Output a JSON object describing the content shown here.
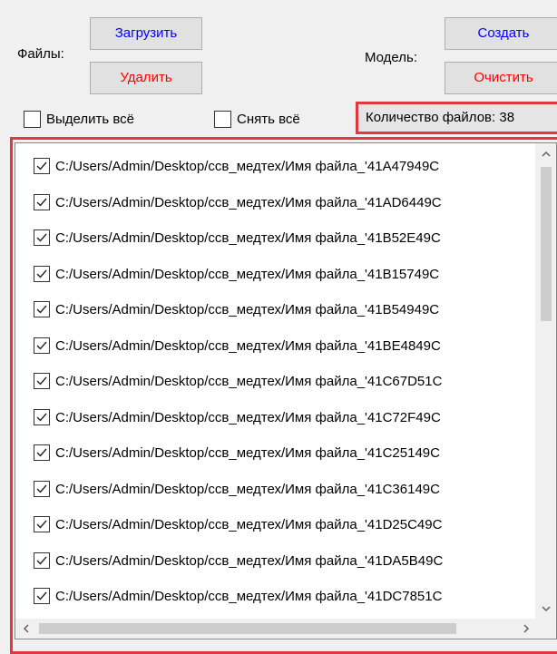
{
  "files": {
    "label": "Файлы:",
    "load_label": "Загрузить",
    "delete_label": "Удалить"
  },
  "model": {
    "label": "Модель:",
    "create_label": "Создать",
    "clear_label": "Очистить"
  },
  "selection": {
    "select_all_label": "Выделить всё",
    "deselect_all_label": "Снять всё"
  },
  "file_count": {
    "text": "Количество файлов: 38"
  },
  "file_list": {
    "items": [
      {
        "path": "C:/Users/Admin/Desktop/ссв_медтех/Имя файла_'41A47949C",
        "checked": true
      },
      {
        "path": "C:/Users/Admin/Desktop/ссв_медтех/Имя файла_'41AD6449C",
        "checked": true
      },
      {
        "path": "C:/Users/Admin/Desktop/ссв_медтех/Имя файла_'41B52E49C",
        "checked": true
      },
      {
        "path": "C:/Users/Admin/Desktop/ссв_медтех/Имя файла_'41B15749C",
        "checked": true
      },
      {
        "path": "C:/Users/Admin/Desktop/ссв_медтех/Имя файла_'41B54949C",
        "checked": true
      },
      {
        "path": "C:/Users/Admin/Desktop/ссв_медтех/Имя файла_'41BE4849C",
        "checked": true
      },
      {
        "path": "C:/Users/Admin/Desktop/ссв_медтех/Имя файла_'41C67D51C",
        "checked": true
      },
      {
        "path": "C:/Users/Admin/Desktop/ссв_медтех/Имя файла_'41C72F49C",
        "checked": true
      },
      {
        "path": "C:/Users/Admin/Desktop/ссв_медтех/Имя файла_'41C25149C",
        "checked": true
      },
      {
        "path": "C:/Users/Admin/Desktop/ссв_медтех/Имя файла_'41C36149C",
        "checked": true
      },
      {
        "path": "C:/Users/Admin/Desktop/ссв_медтех/Имя файла_'41D25C49C",
        "checked": true
      },
      {
        "path": "C:/Users/Admin/Desktop/ссв_медтех/Имя файла_'41DA5B49C",
        "checked": true
      },
      {
        "path": "C:/Users/Admin/Desktop/ссв_медтех/Имя файла_'41DC7851C",
        "checked": true
      }
    ]
  },
  "colors": {
    "highlight_border": "#e0383e",
    "button_text_blue": "#0000ff",
    "button_text_red": "#ff0000"
  },
  "icons": {
    "checkmark": "check-icon",
    "scroll_up": "chevron-up-icon",
    "scroll_down": "chevron-down-icon",
    "scroll_left": "chevron-left-icon",
    "scroll_right": "chevron-right-icon"
  }
}
